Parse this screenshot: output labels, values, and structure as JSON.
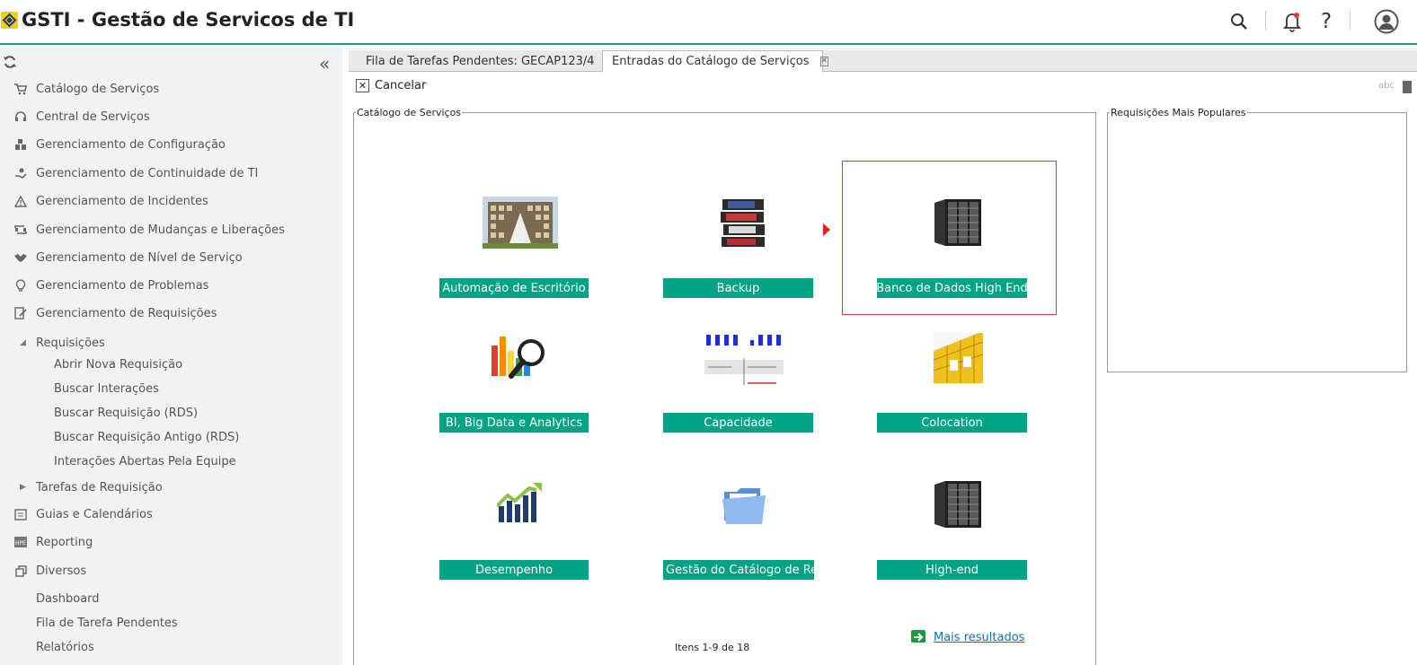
{
  "header": {
    "title": "GSTI - Gestão de Servicos de TI",
    "icons": [
      "search-icon",
      "bell-icon",
      "help-icon",
      "user-icon"
    ],
    "notification_dot_color": "#e53935"
  },
  "sidebar": {
    "items": [
      {
        "label": "Catálogo de Serviços",
        "icon": "cart-icon"
      },
      {
        "label": "Central de Serviços",
        "icon": "headset-icon"
      },
      {
        "label": "Gerenciamento de Configuração",
        "icon": "blocks-icon"
      },
      {
        "label": "Gerenciamento de Continuidade de TI",
        "icon": "hand-icon"
      },
      {
        "label": "Gerenciamento de Incidentes",
        "icon": "warning-icon"
      },
      {
        "label": "Gerenciamento de Mudanças e Liberações",
        "icon": "change-icon"
      },
      {
        "label": "Gerenciamento de Nível de Serviço",
        "icon": "handshake-icon"
      },
      {
        "label": "Gerenciamento de Problemas",
        "icon": "bulb-icon"
      },
      {
        "label": "Gerenciamento de Requisições",
        "icon": "edit-doc-icon"
      }
    ],
    "requisicoes": {
      "label": "Requisições",
      "children": [
        "Abrir Nova Requisição",
        "Buscar Interações",
        "Buscar Requisição (RDS)",
        "Buscar Requisição Antigo (RDS)",
        "Interações Abertas Pela Equipe"
      ]
    },
    "tarefas": "Tarefas de Requisição",
    "bottom_items": [
      {
        "label": "Guias e Calendários",
        "icon": "guide-icon"
      },
      {
        "label": "Reporting",
        "icon": "hpe-icon"
      },
      {
        "label": "Diversos",
        "icon": "copy-icon"
      }
    ],
    "diversos_children": [
      "Dashboard",
      "Fila de Tarefa Pendentes",
      "Relatórios"
    ]
  },
  "tabs": [
    {
      "label": "Fila de Tarefas Pendentes: GECAP123/4"
    },
    {
      "label": "Entradas do Catálogo de Serviços",
      "active": true
    }
  ],
  "toolbar": {
    "cancel_label": "Cancelar"
  },
  "catalog": {
    "legend": "Catálogo de Serviços",
    "tiles": [
      {
        "label": "Automação de Escritório",
        "icon": "office-building-icon"
      },
      {
        "label": "Backup",
        "icon": "tape-backup-icon"
      },
      {
        "label": "Banco de Dados High End",
        "icon": "server-rack-icon",
        "selected": true
      },
      {
        "label": "BI, Big Data e Analytics",
        "icon": "chart-magnifier-icon"
      },
      {
        "label": "Capacidade",
        "icon": "capacity-chart-icon"
      },
      {
        "label": "Colocation",
        "icon": "colocation-icon"
      },
      {
        "label": "Desempenho",
        "icon": "performance-chart-icon"
      },
      {
        "label": "Gestão do Catálogo de Requ",
        "icon": "folder-icon"
      },
      {
        "label": "High-end",
        "icon": "server-rack-icon"
      }
    ],
    "pager": "Itens 1-9 de 18",
    "more_results": "Mais resultados"
  },
  "popular": {
    "legend": "Requisições Mais Populares"
  },
  "colors": {
    "accent": "#00a383",
    "header_line": "#1e9e80",
    "selection": "#e23a3a"
  }
}
